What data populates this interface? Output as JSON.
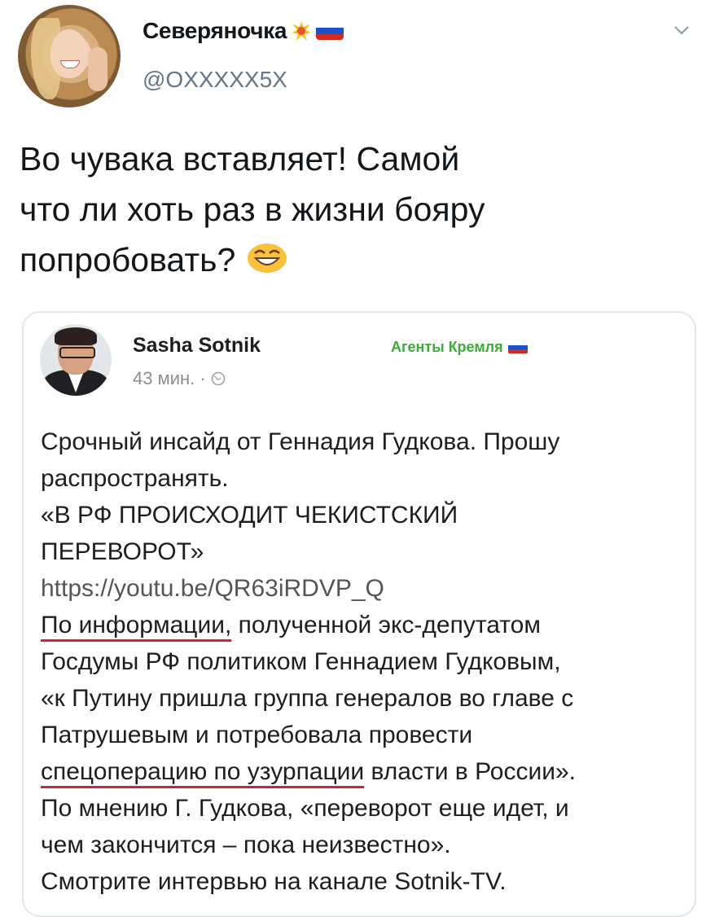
{
  "tweet": {
    "display_name": "Северяночка",
    "name_icons": [
      "collision-emoji",
      "russian-flag-icon"
    ],
    "handle": "@OXXXXX5X",
    "text_lines": [
      "Во чувака вставляет! Самой",
      "что ли хоть раз в жизни бояру",
      "попробовать?"
    ],
    "text_emoji": "grinning-squinting-emoji"
  },
  "embedded_post": {
    "author": "Sasha Sotnik",
    "time": "43 мин. ·",
    "time_icon": "globe-icon",
    "group": "Агенты Кремля",
    "group_icon": "russian-flag-icon",
    "lines": [
      {
        "text": "Срочный инсайд от Геннадия Гудкова. Прошу",
        "type": "text"
      },
      {
        "text": "распространять.",
        "type": "text"
      },
      {
        "text": "«В РФ ПРОИСХОДИТ ЧЕКИСТСКИЙ",
        "type": "text"
      },
      {
        "text": "ПЕРЕВОРОТ»",
        "type": "text"
      },
      {
        "text": "https://youtu.be/QR63iRDVP_Q",
        "type": "url"
      },
      {
        "text_underlined": "По информации,",
        "text_rest": " полученной экс-депутатом",
        "type": "underlined"
      },
      {
        "text": "Госдумы РФ политиком Геннадием Гудковым,",
        "type": "text"
      },
      {
        "text": "«к Путину пришла группа генералов во главе с",
        "type": "text"
      },
      {
        "text": "Патрушевым и потребовала провести",
        "type": "text"
      },
      {
        "text_underlined": "спецоперацию по узурпации",
        "text_rest": " власти в России».",
        "type": "underlined"
      },
      {
        "text": "По мнению Г. Гудкова, «переворот еще идет, и",
        "type": "text"
      },
      {
        "text": "чем закончится – пока неизвестно».",
        "type": "text"
      },
      {
        "text": "Смотрите интервью на канале Sotnik-TV.",
        "type": "text"
      }
    ]
  },
  "colors": {
    "text": "#14171a",
    "muted": "#657786",
    "group_green": "#3cab37",
    "underline_red": "#c8282e",
    "card_border": "#e1e8ed"
  }
}
